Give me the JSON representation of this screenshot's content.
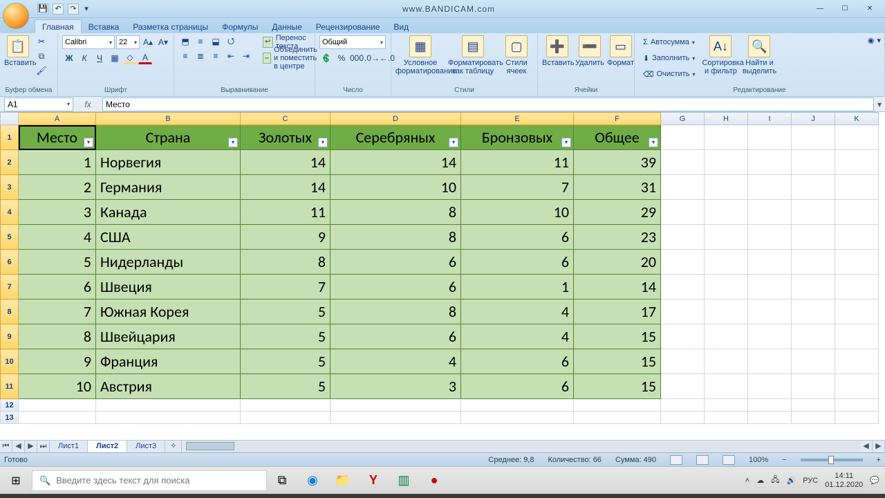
{
  "watermark": "www.BANDICAM.com",
  "app": {
    "namebox": "A1",
    "formula": "Место",
    "font": "Calibri",
    "fontsize": "22",
    "number_format": "Общий"
  },
  "ribbon_tabs": [
    "Главная",
    "Вставка",
    "Разметка страницы",
    "Формулы",
    "Данные",
    "Рецензирование",
    "Вид"
  ],
  "ribbon_groups": {
    "clipboard": {
      "label": "Буфер обмена",
      "paste": "Вставить"
    },
    "font": {
      "label": "Шрифт"
    },
    "align": {
      "label": "Выравнивание",
      "wrap": "Перенос текста",
      "merge": "Объединить и поместить в центре"
    },
    "number": {
      "label": "Число"
    },
    "styles": {
      "label": "Стили",
      "cond": "Условное форматирование",
      "astable": "Форматировать как таблицу",
      "cellstyles": "Стили ячеек"
    },
    "cells": {
      "label": "Ячейки",
      "insert": "Вставить",
      "delete": "Удалить",
      "format": "Формат"
    },
    "editing": {
      "label": "Редактирование",
      "autosum": "Автосумма",
      "fill": "Заполнить",
      "clear": "Очистить",
      "sort": "Сортировка и фильтр",
      "find": "Найти и выделить"
    }
  },
  "columns": [
    "A",
    "B",
    "C",
    "D",
    "E",
    "F",
    "G",
    "H",
    "I",
    "J",
    "K"
  ],
  "table": {
    "headers": [
      "Место",
      "Страна",
      "Золотых",
      "Серебряных",
      "Бронзовых",
      "Общее"
    ],
    "rows": [
      {
        "place": 1,
        "country": "Норвегия",
        "gold": 14,
        "silver": 14,
        "bronze": 11,
        "total": 39
      },
      {
        "place": 2,
        "country": "Германия",
        "gold": 14,
        "silver": 10,
        "bronze": 7,
        "total": 31
      },
      {
        "place": 3,
        "country": "Канада",
        "gold": 11,
        "silver": 8,
        "bronze": 10,
        "total": 29
      },
      {
        "place": 4,
        "country": "США",
        "gold": 9,
        "silver": 8,
        "bronze": 6,
        "total": 23
      },
      {
        "place": 5,
        "country": "Нидерланды",
        "gold": 8,
        "silver": 6,
        "bronze": 6,
        "total": 20
      },
      {
        "place": 6,
        "country": "Швеция",
        "gold": 7,
        "silver": 6,
        "bronze": 1,
        "total": 14
      },
      {
        "place": 7,
        "country": "Южная Корея",
        "gold": 5,
        "silver": 8,
        "bronze": 4,
        "total": 17
      },
      {
        "place": 8,
        "country": "Швейцария",
        "gold": 5,
        "silver": 6,
        "bronze": 4,
        "total": 15
      },
      {
        "place": 9,
        "country": "Франция",
        "gold": 5,
        "silver": 4,
        "bronze": 6,
        "total": 15
      },
      {
        "place": 10,
        "country": "Австрия",
        "gold": 5,
        "silver": 3,
        "bronze": 6,
        "total": 15
      }
    ]
  },
  "sheet_tabs": [
    "Лист1",
    "Лист2",
    "Лист3"
  ],
  "active_sheet": 1,
  "status": {
    "ready": "Готово",
    "avg_label": "Среднее:",
    "avg": "9,8",
    "count_label": "Количество:",
    "count": "66",
    "sum_label": "Сумма:",
    "sum": "490",
    "zoom": "100%"
  },
  "taskbar": {
    "search_placeholder": "Введите здесь текст для поиска",
    "lang": "РУС",
    "time": "14:11",
    "date": "01.12.2020"
  }
}
